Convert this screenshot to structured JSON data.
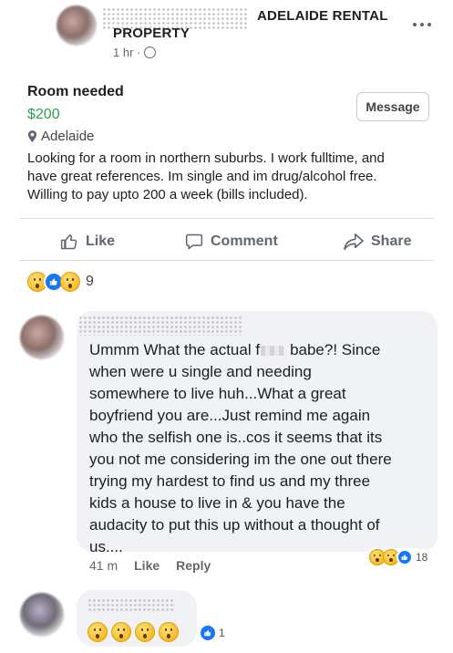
{
  "post": {
    "group_name_line1": "ADELAIDE RENTAL",
    "group_name_line2": "PROPERTY",
    "time": "1 hr ·",
    "title": "Room needed",
    "price": "$200",
    "location": "Adelaide",
    "message_button": "Message",
    "body_line1": "Looking for a room in northern suburbs. I work fulltime, and",
    "body_line2": "have great references. Im single and im drug/alcohol free.",
    "body_line3": "Willing to pay upto 200 a week (bills included).",
    "actions": {
      "like": "Like",
      "comment": "Comment",
      "share": "Share"
    },
    "reaction_count": "9"
  },
  "comment1": {
    "lines": [
      "Ummm What the actual f",
      "when were u single and needing",
      "somewhere to live huh...What a great",
      "boyfriend you are...Just remind me again",
      "who the selfish one is..cos it seems that its",
      "you not me considering im the one out there",
      "trying my  hardest to find us and my three",
      "kids a house to live in & you have the",
      "audacity to put this up without a thought of",
      "us...."
    ],
    "line1_tail": "babe?! Since",
    "time": "41 m",
    "like": "Like",
    "reply": "Reply",
    "reaction_count": "18"
  },
  "comment2": {
    "reaction_count": "1"
  },
  "colors": {
    "price_green": "#2e9e4f",
    "facebook_blue": "#1877f2",
    "bubble_gray": "#f0f2f5"
  }
}
